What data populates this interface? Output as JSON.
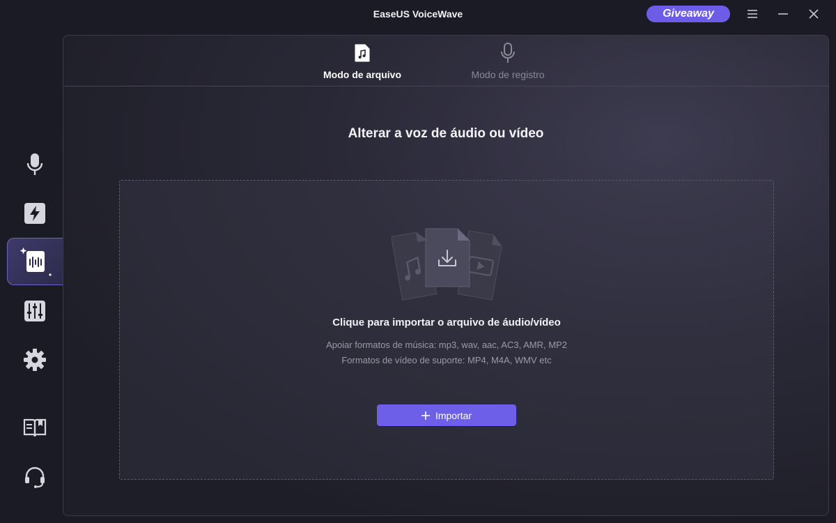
{
  "app": {
    "title": "EaseUS VoiceWave"
  },
  "titlebar": {
    "giveaway_label": "Giveaway",
    "menu_icon": "hamburger-menu-icon",
    "minimize_icon": "minimize-icon",
    "close_icon": "close-icon"
  },
  "sidebar": {
    "items": [
      {
        "id": "microphone",
        "icon": "microphone-icon",
        "active": false
      },
      {
        "id": "effects",
        "icon": "lightning-icon",
        "active": false
      },
      {
        "id": "file-voice-changer",
        "icon": "audio-file-wave-icon",
        "active": true
      },
      {
        "id": "equalizer",
        "icon": "sliders-icon",
        "active": false
      },
      {
        "id": "settings",
        "icon": "gear-icon",
        "active": false
      },
      {
        "id": "guide",
        "icon": "book-icon",
        "active": false
      },
      {
        "id": "support",
        "icon": "headset-icon",
        "active": false
      }
    ]
  },
  "tabs": [
    {
      "label": "Modo de arquivo",
      "icon": "music-file-icon",
      "active": true
    },
    {
      "label": "Modo de registro",
      "icon": "microphone-icon",
      "active": false
    }
  ],
  "main": {
    "headline": "Alterar a voz de áudio ou vídeo",
    "dropzone": {
      "title": "Clique para importar o arquivo de áudio/vídeo",
      "music_formats": "Apoiar formatos de música: mp3, wav, aac, AC3, AMR, MP2",
      "video_formats": "Formatos de vídeo de suporte: MP4, M4A, WMV etc",
      "illustration_icon": "import-files-icon"
    },
    "import_button": {
      "label": "Importar",
      "icon": "plus-icon"
    }
  },
  "colors": {
    "accent": "#6d5fe8",
    "giveaway": "#6c5ce7",
    "background": "#1b1b26"
  }
}
